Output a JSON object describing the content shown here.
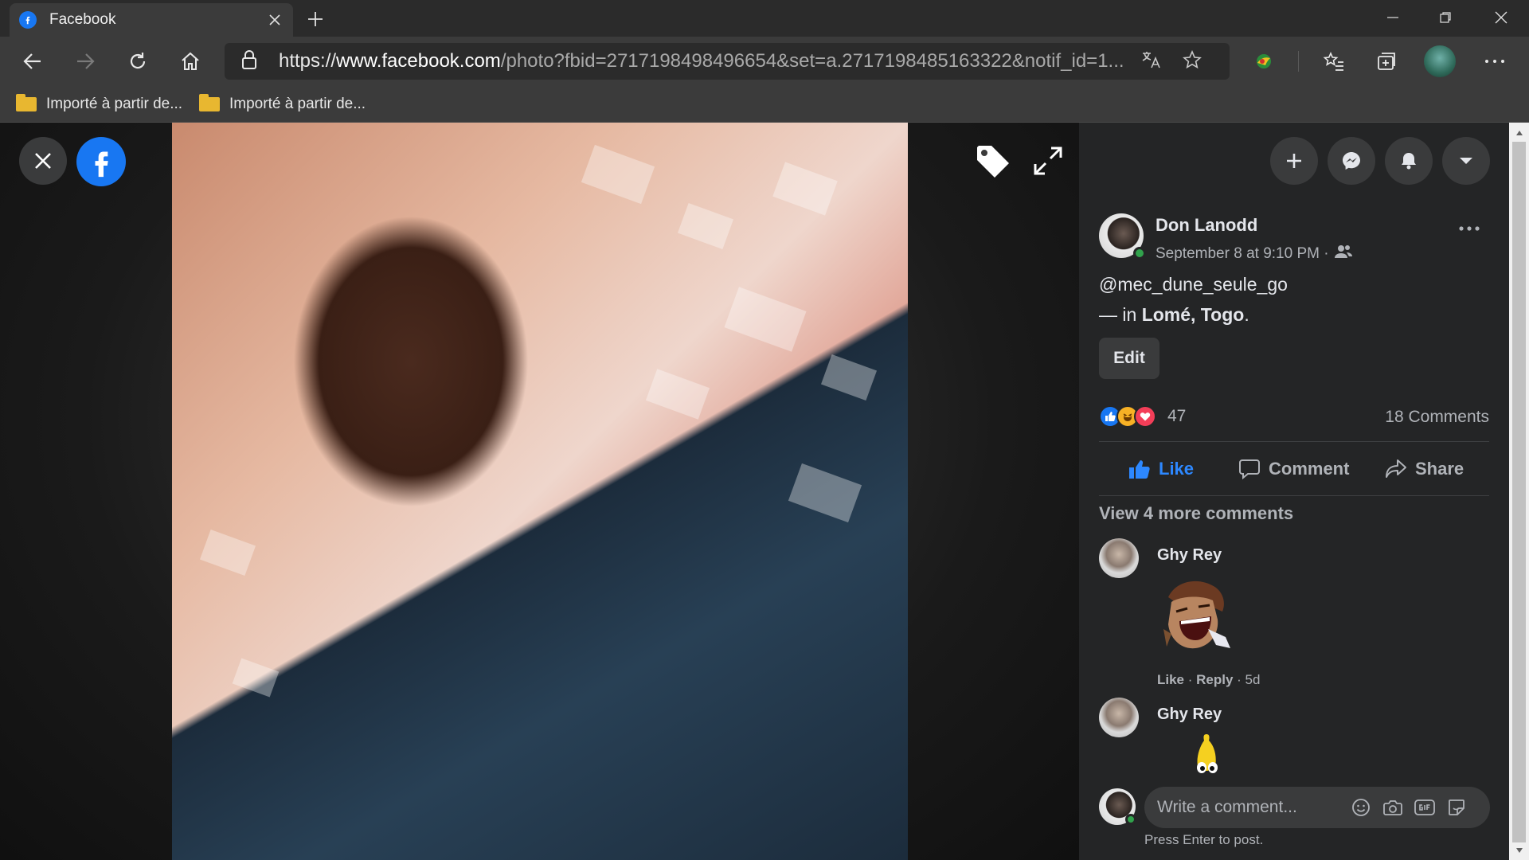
{
  "browser": {
    "tab_title": "Facebook",
    "url_scheme": "https://",
    "url_host": "www.facebook.com",
    "url_path": "/photo?fbid=2717198498496654&set=a.2717198485163322&notif_id=1...",
    "bookmarks": [
      {
        "label": "Importé à partir de..."
      },
      {
        "label": "Importé à partir de..."
      }
    ]
  },
  "post": {
    "author": "Don Lanodd",
    "timestamp": "September 8 at 9:10 PM · ",
    "caption_handle": "@mec_dune_seule_go",
    "location_prefix": "— in ",
    "location": "Lomé, Togo",
    "location_suffix": ".",
    "edit_label": "Edit",
    "reaction_count": "47",
    "comment_count": "18 Comments",
    "actions": {
      "like": "Like",
      "comment": "Comment",
      "share": "Share"
    },
    "view_more": "View 4 more comments"
  },
  "comments": [
    {
      "author": "Ghy Rey",
      "like": "Like",
      "reply": "Reply",
      "time": "5d",
      "sep": " · "
    },
    {
      "author": "Ghy Rey"
    }
  ],
  "composer": {
    "placeholder": "Write a comment...",
    "hint": "Press Enter to post."
  },
  "colors": {
    "accent": "#1877f2",
    "panel": "#242526",
    "online": "#31a24c"
  }
}
